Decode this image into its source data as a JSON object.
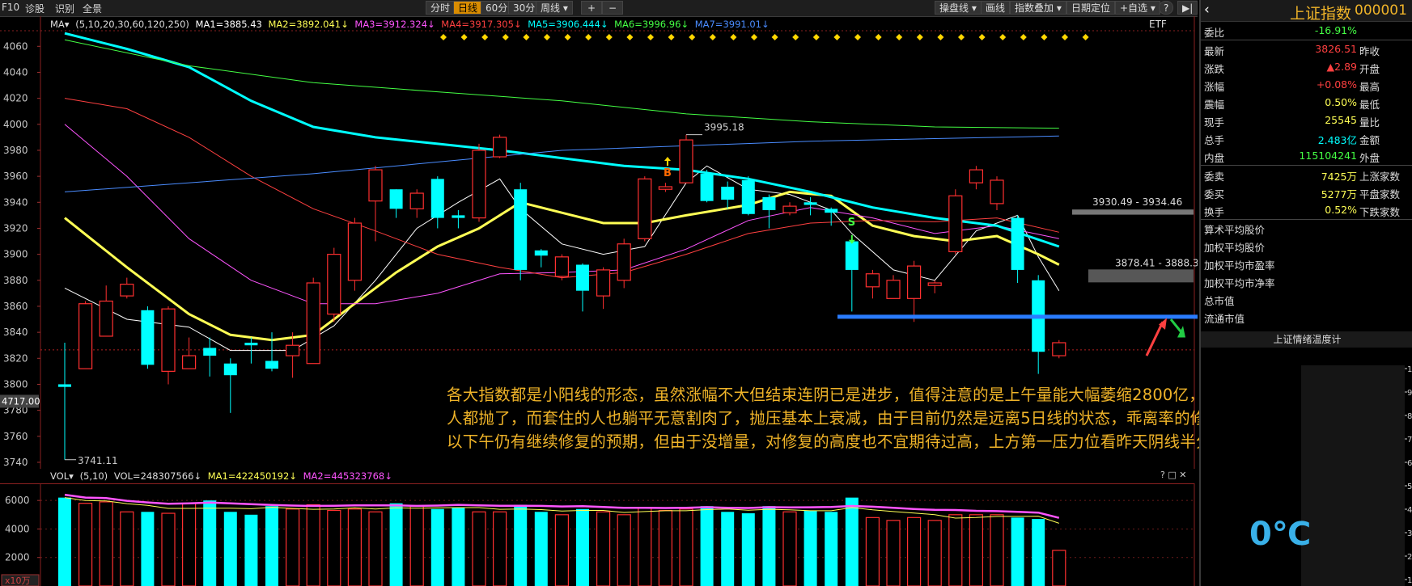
{
  "toolbar": {
    "left_items": [
      "F10",
      "诊股",
      "识别",
      "全景"
    ],
    "period_buttons": [
      "分时",
      "日线",
      "60分",
      "30分",
      "周线 ▾"
    ],
    "zoom_plus": "+",
    "zoom_minus": "−",
    "right_buttons": [
      "操盘线 ▾",
      "画线",
      "指数叠加 ▾",
      "日期定位",
      "+自选 ▾"
    ],
    "help": "?",
    "last": "▶|"
  },
  "ma_legend": {
    "prefix": "MA▾",
    "params": "(5,10,20,30,60,120,250)",
    "items": [
      {
        "text": "MA1=3885.43",
        "color": "#ffffff"
      },
      {
        "text": "MA2=3892.041↓",
        "color": "#ffff55"
      },
      {
        "text": "MA3=3912.324↓",
        "color": "#ff55ff"
      },
      {
        "text": "MA4=3917.305↓",
        "color": "#ff4040"
      },
      {
        "text": "MA5=3906.444↓",
        "color": "#00ffff"
      },
      {
        "text": "MA6=3996.96↓",
        "color": "#44ff44"
      },
      {
        "text": "MA7=3991.01↓",
        "color": "#4a8cff"
      }
    ],
    "etf": "ETF"
  },
  "price_axis": {
    "ticks": [
      "4060",
      "4040",
      "4020",
      "4000",
      "3980",
      "3960",
      "3940",
      "3920",
      "3900",
      "3880",
      "3860",
      "3840",
      "3820",
      "3800",
      "3780",
      "3760",
      "3740"
    ],
    "current_tag": "4717.00"
  },
  "price_labels": {
    "high_point": "3995.18",
    "low_point": "3741.11",
    "resistance_label": "3930.49 - 3934.46",
    "support_label": "3878.41 - 3888.37",
    "signal_b": "B",
    "signal_s": "S"
  },
  "vol_legend": {
    "prefix": "VOL▾",
    "params": "(5,10)",
    "items": [
      {
        "text": "VOL=248307566↓",
        "color": "#dddddd"
      },
      {
        "text": "MA1=422450192↓",
        "color": "#ffff55"
      },
      {
        "text": "MA2=445323768↓",
        "color": "#ff55ff"
      }
    ],
    "controls": "? □ ✕"
  },
  "vol_axis": {
    "ticks": [
      "6000",
      "4000",
      "2000"
    ],
    "unit": "x10万"
  },
  "annotation": "各大指数都是小阳线的形态，虽然涨幅不大但结束连阴已是进步，值得注意的是上午量能大幅萎缩2800亿，说明节前想抛售的人都抛了，而套住的人也躺平无意割肉了，抛压基本上衰减，由于目前仍然是远离5日线的状态，乖离率的修复还不算充分，所以下午仍有继续修复的预期，但由于没增量，对修复的高度也不宜期待过高，上方第一压力位看昨天阴线半分位附近。",
  "quote": {
    "name": "上证指数",
    "code": "000001",
    "rows1": [
      {
        "k": "委比",
        "v": "-16.91%",
        "vc": "#44ff44",
        "k2": ""
      }
    ],
    "rows2": [
      {
        "k": "最新",
        "v": "3826.51",
        "vc": "#ff4040",
        "k2": "昨收"
      },
      {
        "k": "涨跌",
        "v": "▲2.89",
        "vc": "#ff4040",
        "k2": "开盘"
      },
      {
        "k": "涨幅",
        "v": "+0.08%",
        "vc": "#ff4040",
        "k2": "最高"
      },
      {
        "k": "震幅",
        "v": "0.50%",
        "vc": "#ffff55",
        "k2": "最低"
      },
      {
        "k": "现手",
        "v": "25545",
        "vc": "#ffff55",
        "k2": "量比"
      },
      {
        "k": "总手",
        "v": "2.483亿",
        "vc": "#00ffff",
        "k2": "金额"
      },
      {
        "k": "内盘",
        "v": "115104241",
        "vc": "#44ff44",
        "k2": "外盘"
      }
    ],
    "rows3": [
      {
        "k": "委卖",
        "v": "7425万",
        "vc": "#ffff55",
        "k2": "上涨家数"
      },
      {
        "k": "委买",
        "v": "5277万",
        "vc": "#ffff55",
        "k2": "平盘家数"
      },
      {
        "k": "换手",
        "v": "0.52%",
        "vc": "#ffff55",
        "k2": "下跌家数"
      }
    ],
    "stats": [
      "算术平均股价",
      "加权平均股价",
      "加权平均市盈率",
      "加权平均市净率",
      "总市值",
      "流通市值"
    ],
    "thermo_title": "上证情绪温度计",
    "temperature": "0℃",
    "thermo_ticks": [
      "1",
      "9",
      "8",
      "7",
      "6",
      "5",
      "4",
      "3",
      "2",
      "1"
    ]
  },
  "chart_data": {
    "type": "candlestick",
    "ylim": [
      3735,
      4072
    ],
    "candles": [
      [
        3800,
        3798,
        3832,
        3742
      ],
      [
        3812,
        3862,
        3864,
        3812
      ],
      [
        3837,
        3864,
        3876,
        3837
      ],
      [
        3868,
        3877,
        3882,
        3866
      ],
      [
        3857,
        3815,
        3860,
        3812
      ],
      [
        3810,
        3858,
        3860,
        3800
      ],
      [
        3812,
        3822,
        3836,
        3812
      ],
      [
        3828,
        3822,
        3836,
        3806
      ],
      [
        3816,
        3807,
        3820,
        3778
      ],
      [
        3832,
        3830,
        3836,
        3816
      ],
      [
        3818,
        3812,
        3840,
        3810
      ],
      [
        3822,
        3830,
        3840,
        3805
      ],
      [
        3816,
        3878,
        3882,
        3816
      ],
      [
        3854,
        3900,
        3905,
        3848
      ],
      [
        3880,
        3924,
        3928,
        3872
      ],
      [
        3941,
        3965,
        3968,
        3910
      ],
      [
        3950,
        3935,
        3950,
        3928
      ],
      [
        3935,
        3947,
        3950,
        3928
      ],
      [
        3958,
        3928,
        3960,
        3920
      ],
      [
        3930,
        3928,
        3934,
        3920
      ],
      [
        3928,
        3980,
        3985,
        3925
      ],
      [
        3975,
        3990,
        3992,
        3974
      ],
      [
        3950,
        3888,
        3955,
        3880
      ],
      [
        3903,
        3899,
        3904,
        3890
      ],
      [
        3883,
        3898,
        3900,
        3880
      ],
      [
        3892,
        3872,
        3893,
        3856
      ],
      [
        3868,
        3888,
        3890,
        3858
      ],
      [
        3880,
        3908,
        3912,
        3874
      ],
      [
        3912,
        3958,
        3960,
        3910
      ],
      [
        3950,
        3952,
        3955,
        3948
      ],
      [
        3955,
        3988,
        3992,
        3955
      ],
      [
        3962,
        3941,
        3965,
        3940
      ],
      [
        3952,
        3942,
        3956,
        3935
      ],
      [
        3957,
        3931,
        3960,
        3930
      ],
      [
        3944,
        3934,
        3946,
        3920
      ],
      [
        3932,
        3937,
        3940,
        3930
      ],
      [
        3940,
        3938,
        3944,
        3930
      ],
      [
        3935,
        3932,
        3936,
        3922
      ],
      [
        3910,
        3888,
        3912,
        3856
      ],
      [
        3875,
        3885,
        3888,
        3866
      ],
      [
        3866,
        3880,
        3884,
        3866
      ],
      [
        3866,
        3891,
        3895,
        3848
      ],
      [
        3876,
        3878,
        3880,
        3870
      ],
      [
        3902,
        3945,
        3950,
        3900
      ],
      [
        3955,
        3965,
        3968,
        3950
      ],
      [
        3939,
        3957,
        3960,
        3934
      ],
      [
        3928,
        3888,
        3930,
        3878
      ],
      [
        3880,
        3825,
        3884,
        3808
      ],
      [
        3822,
        3832,
        3834,
        3820
      ]
    ],
    "ma_lines": [
      {
        "name": "MA1",
        "color": "#ffffff",
        "width": 1,
        "pts": [
          [
            0,
            3874
          ],
          [
            3,
            3850
          ],
          [
            6,
            3844
          ],
          [
            8,
            3826
          ],
          [
            11,
            3826
          ],
          [
            13,
            3845
          ],
          [
            15,
            3880
          ],
          [
            17,
            3920
          ],
          [
            19,
            3940
          ],
          [
            21,
            3958
          ],
          [
            22,
            3935
          ],
          [
            24,
            3908
          ],
          [
            26,
            3900
          ],
          [
            28,
            3906
          ],
          [
            30,
            3955
          ],
          [
            31,
            3968
          ],
          [
            33,
            3950
          ],
          [
            35,
            3946
          ],
          [
            37,
            3934
          ],
          [
            38,
            3916
          ],
          [
            40,
            3888
          ],
          [
            42,
            3880
          ],
          [
            44,
            3918
          ],
          [
            46,
            3930
          ],
          [
            47,
            3898
          ],
          [
            48,
            3872
          ]
        ]
      },
      {
        "name": "MA2",
        "color": "#ffff55",
        "width": 3,
        "pts": [
          [
            0,
            3928
          ],
          [
            3,
            3890
          ],
          [
            6,
            3854
          ],
          [
            8,
            3838
          ],
          [
            10,
            3834
          ],
          [
            12,
            3838
          ],
          [
            14,
            3862
          ],
          [
            16,
            3886
          ],
          [
            18,
            3906
          ],
          [
            20,
            3920
          ],
          [
            22,
            3940
          ],
          [
            24,
            3932
          ],
          [
            26,
            3924
          ],
          [
            28,
            3924
          ],
          [
            30,
            3930
          ],
          [
            33,
            3938
          ],
          [
            35,
            3948
          ],
          [
            37,
            3945
          ],
          [
            39,
            3922
          ],
          [
            41,
            3914
          ],
          [
            43,
            3910
          ],
          [
            45,
            3914
          ],
          [
            47,
            3900
          ],
          [
            48,
            3892
          ]
        ]
      },
      {
        "name": "MA3",
        "color": "#ff55ff",
        "width": 1,
        "pts": [
          [
            0,
            4000
          ],
          [
            3,
            3960
          ],
          [
            6,
            3912
          ],
          [
            9,
            3880
          ],
          [
            12,
            3862
          ],
          [
            15,
            3862
          ],
          [
            18,
            3870
          ],
          [
            21,
            3885
          ],
          [
            24,
            3886
          ],
          [
            27,
            3888
          ],
          [
            30,
            3904
          ],
          [
            33,
            3926
          ],
          [
            36,
            3936
          ],
          [
            39,
            3928
          ],
          [
            42,
            3916
          ],
          [
            45,
            3922
          ],
          [
            48,
            3912
          ]
        ]
      },
      {
        "name": "MA4",
        "color": "#ff4040",
        "width": 1,
        "pts": [
          [
            0,
            4020
          ],
          [
            3,
            4012
          ],
          [
            6,
            3990
          ],
          [
            9,
            3960
          ],
          [
            12,
            3935
          ],
          [
            15,
            3918
          ],
          [
            18,
            3900
          ],
          [
            21,
            3890
          ],
          [
            24,
            3882
          ],
          [
            27,
            3886
          ],
          [
            30,
            3900
          ],
          [
            33,
            3916
          ],
          [
            36,
            3924
          ],
          [
            39,
            3926
          ],
          [
            42,
            3925
          ],
          [
            45,
            3928
          ],
          [
            48,
            3917
          ]
        ]
      },
      {
        "name": "MA5",
        "color": "#00ffff",
        "width": 3,
        "pts": [
          [
            0,
            4070
          ],
          [
            3,
            4058
          ],
          [
            6,
            4044
          ],
          [
            9,
            4018
          ],
          [
            12,
            3998
          ],
          [
            15,
            3990
          ],
          [
            18,
            3985
          ],
          [
            21,
            3980
          ],
          [
            24,
            3974
          ],
          [
            27,
            3968
          ],
          [
            30,
            3965
          ],
          [
            33,
            3958
          ],
          [
            36,
            3948
          ],
          [
            39,
            3936
          ],
          [
            42,
            3928
          ],
          [
            45,
            3922
          ],
          [
            48,
            3906
          ]
        ]
      },
      {
        "name": "MA6",
        "color": "#44ff44",
        "width": 1,
        "pts": [
          [
            0,
            4065
          ],
          [
            6,
            4045
          ],
          [
            12,
            4032
          ],
          [
            18,
            4025
          ],
          [
            24,
            4018
          ],
          [
            30,
            4008
          ],
          [
            36,
            4002
          ],
          [
            42,
            3998
          ],
          [
            48,
            3997
          ]
        ]
      },
      {
        "name": "MA7",
        "color": "#4a8cff",
        "width": 1,
        "pts": [
          [
            0,
            3948
          ],
          [
            12,
            3962
          ],
          [
            24,
            3980
          ],
          [
            36,
            3987
          ],
          [
            48,
            3991
          ]
        ]
      }
    ],
    "volume": [
      62,
      58,
      59,
      52,
      52,
      51,
      58,
      60,
      52,
      50,
      56,
      54,
      57,
      53,
      54,
      52,
      58,
      56,
      54,
      55,
      52,
      52,
      57,
      52,
      50,
      54,
      52,
      50,
      55,
      53,
      54,
      56,
      52,
      51,
      56,
      52,
      53,
      52,
      62,
      48,
      46,
      48,
      46,
      50,
      50,
      50,
      48,
      47,
      25
    ],
    "volume_ylim": [
      0,
      7200
    ]
  }
}
